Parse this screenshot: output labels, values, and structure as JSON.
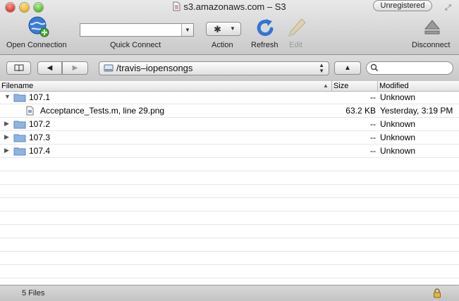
{
  "window": {
    "title": "s3.amazonaws.com – S3",
    "badge": "Unregistered"
  },
  "toolbar": {
    "open_connection": "Open Connection",
    "quick_connect": "Quick Connect",
    "quick_connect_value": "",
    "action": "Action",
    "refresh": "Refresh",
    "edit": "Edit",
    "disconnect": "Disconnect"
  },
  "pathbar": {
    "path": "/travis–iopensongs",
    "search_value": ""
  },
  "columns": {
    "filename": "Filename",
    "size": "Size",
    "modified": "Modified"
  },
  "files": [
    {
      "name": "107.1",
      "type": "folder",
      "expanded": true,
      "size": "--",
      "modified": "Unknown"
    },
    {
      "name": "Acceptance_Tests.m, line 29.png",
      "type": "file",
      "indent": 1,
      "size": "63.2 KB",
      "modified": "Yesterday, 3:19 PM"
    },
    {
      "name": "107.2",
      "type": "folder",
      "expanded": false,
      "size": "--",
      "modified": "Unknown"
    },
    {
      "name": "107.3",
      "type": "folder",
      "expanded": false,
      "size": "--",
      "modified": "Unknown"
    },
    {
      "name": "107.4",
      "type": "folder",
      "expanded": false,
      "size": "--",
      "modified": "Unknown"
    }
  ],
  "status": {
    "count": "5 Files"
  },
  "icons": {
    "open_connection": "globe-plus-icon",
    "action": "gear-icon",
    "refresh": "refresh-arrow-icon",
    "edit": "pencil-icon",
    "disconnect": "eject-icon",
    "folder": "folder-icon",
    "file": "image-file-icon",
    "lock": "lock-icon"
  },
  "colors": {
    "folder": "#8fb4df",
    "refresh": "#2f76d6",
    "disconnect": "#9a9a9a"
  }
}
